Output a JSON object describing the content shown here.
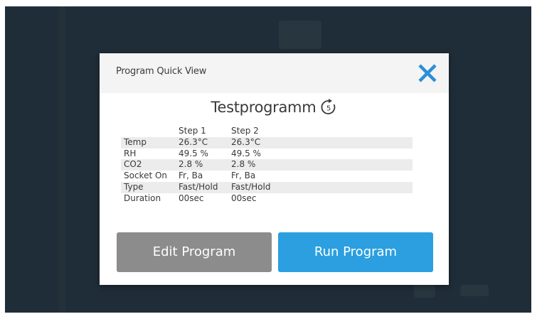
{
  "dialog": {
    "title": "Program Quick View",
    "program_name": "Testprogramm",
    "repeat_count": "5"
  },
  "table": {
    "headers": [
      "",
      "Step 1",
      "Step 2"
    ],
    "rows": [
      {
        "label": "Temp",
        "step1": "26.3°C",
        "step2": "26.3°C"
      },
      {
        "label": "RH",
        "step1": "49.5 %",
        "step2": "49.5 %"
      },
      {
        "label": "CO2",
        "step1": "2.8 %",
        "step2": "2.8 %"
      },
      {
        "label": "Socket On",
        "step1": "Fr, Ba",
        "step2": "Fr, Ba"
      },
      {
        "label": "Type",
        "step1": "Fast/Hold",
        "step2": "Fast/Hold"
      },
      {
        "label": "Duration",
        "step1": "00sec",
        "step2": "00sec"
      }
    ]
  },
  "buttons": {
    "edit_label": "Edit Program",
    "run_label": "Run Program"
  },
  "colors": {
    "overlay_background": "#1f2d38",
    "close_icon": "#2b8fd6",
    "edit_button": "#8c8c8c",
    "run_button": "#2b9fe0"
  },
  "icons": {
    "close": "close-icon",
    "repeat": "repeat-icon"
  }
}
